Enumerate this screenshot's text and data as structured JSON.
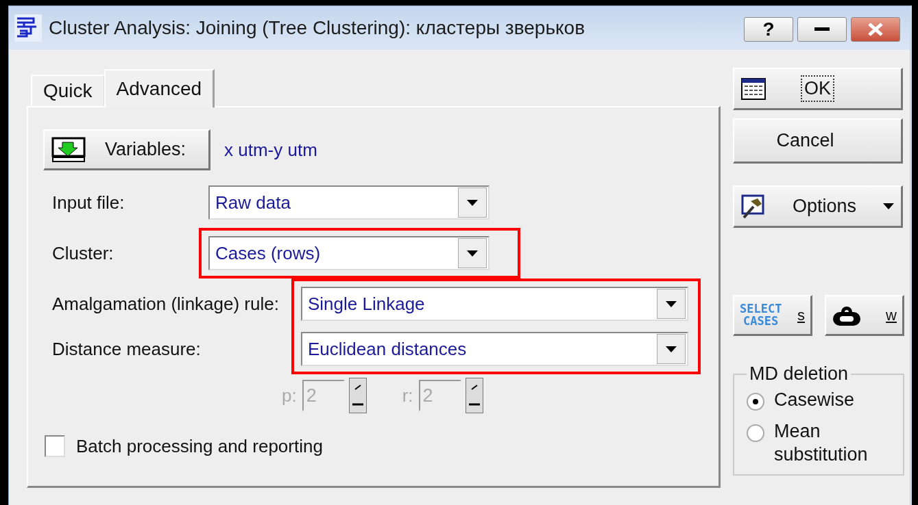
{
  "window": {
    "title": "Cluster Analysis: Joining (Tree Clustering): кластеры зверьков"
  },
  "title_buttons": [
    {
      "kind": "help",
      "label": "?"
    },
    {
      "kind": "minimize"
    },
    {
      "kind": "close"
    }
  ],
  "tabs": [
    {
      "label": "Quick",
      "selected": false
    },
    {
      "label": "Advanced",
      "selected": true
    }
  ],
  "variables": {
    "button": "Variables:",
    "value": "x utm-y utm"
  },
  "input_fields": [
    {
      "label": "Input file:",
      "value": "Raw data",
      "highlighted": false
    },
    {
      "label": "Cluster:",
      "value": "Cases (rows)",
      "highlighted": true
    }
  ],
  "method_fields": [
    {
      "label": "Amalgamation (linkage) rule:",
      "value": "Single Linkage",
      "highlighted": true
    },
    {
      "label": "Distance measure:",
      "value": "Euclidean distances",
      "highlighted": true
    }
  ],
  "parameters": [
    {
      "label": "p:",
      "value": "2",
      "disabled": true
    },
    {
      "label": "r:",
      "value": "2",
      "disabled": true
    }
  ],
  "batch": {
    "label": "Batch processing and reporting",
    "checked": false
  },
  "buttons": [
    {
      "kind": "ok",
      "label": "OK",
      "focused": true
    },
    {
      "kind": "cancel",
      "label": "Cancel",
      "focused": false
    },
    {
      "kind": "options",
      "label": "Options",
      "focused": false
    }
  ],
  "tool_buttons": [
    {
      "kind": "select_cases",
      "icon_text": [
        "SELECT",
        "CASES"
      ],
      "label": "s"
    },
    {
      "kind": "weight",
      "label": "w"
    }
  ],
  "md_deletion": {
    "title": "MD deletion",
    "options": [
      {
        "label": "Casewise",
        "selected": true
      },
      {
        "label": "Mean substitution",
        "selected": false
      }
    ]
  }
}
